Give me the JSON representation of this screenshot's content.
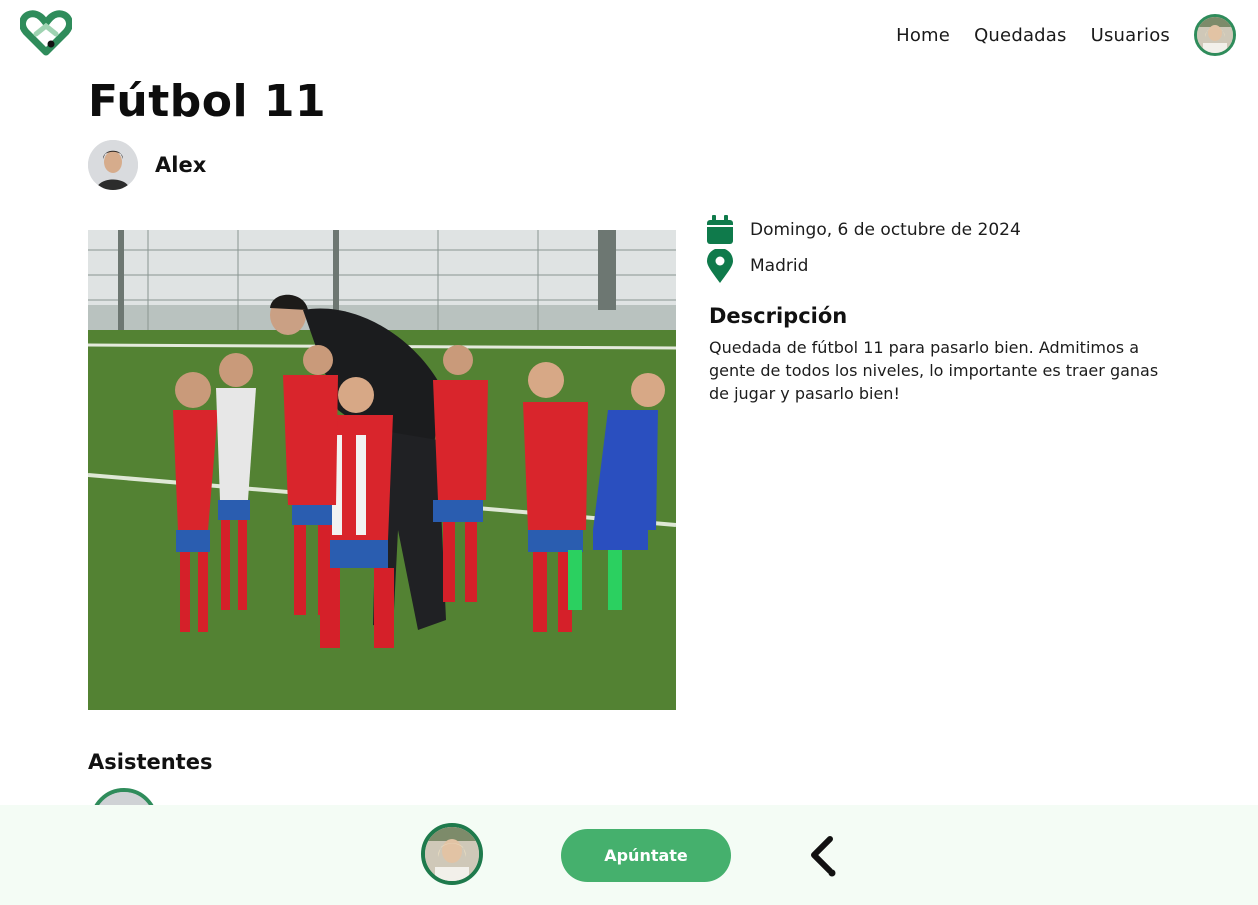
{
  "nav": {
    "logo_icon": "heart-pin-logo-icon",
    "links": [
      {
        "label": "Home"
      },
      {
        "label": "Quedadas"
      },
      {
        "label": "Usuarios"
      }
    ],
    "avatar_icon": "user-avatar"
  },
  "event": {
    "title": "Fútbol 11",
    "author": "Alex",
    "date": "Domingo, 6 de octubre de 2024",
    "location": "Madrid",
    "description_title": "Descripción",
    "description": "Quedada de fútbol 11 para pasarlo bien. Admitimos a gente de todos los niveles, lo importante es traer ganas de jugar y pasarlo bien!"
  },
  "attendees": {
    "title": "Asistentes"
  },
  "bottom_bar": {
    "join_label": "Apúntate",
    "back_icon": "chevron-left-icon"
  },
  "colors": {
    "brand_green": "#2f8c5b",
    "button_green": "#45b06d",
    "icon_green": "#0f7a4b",
    "bar_background": "#f4fcf5"
  }
}
